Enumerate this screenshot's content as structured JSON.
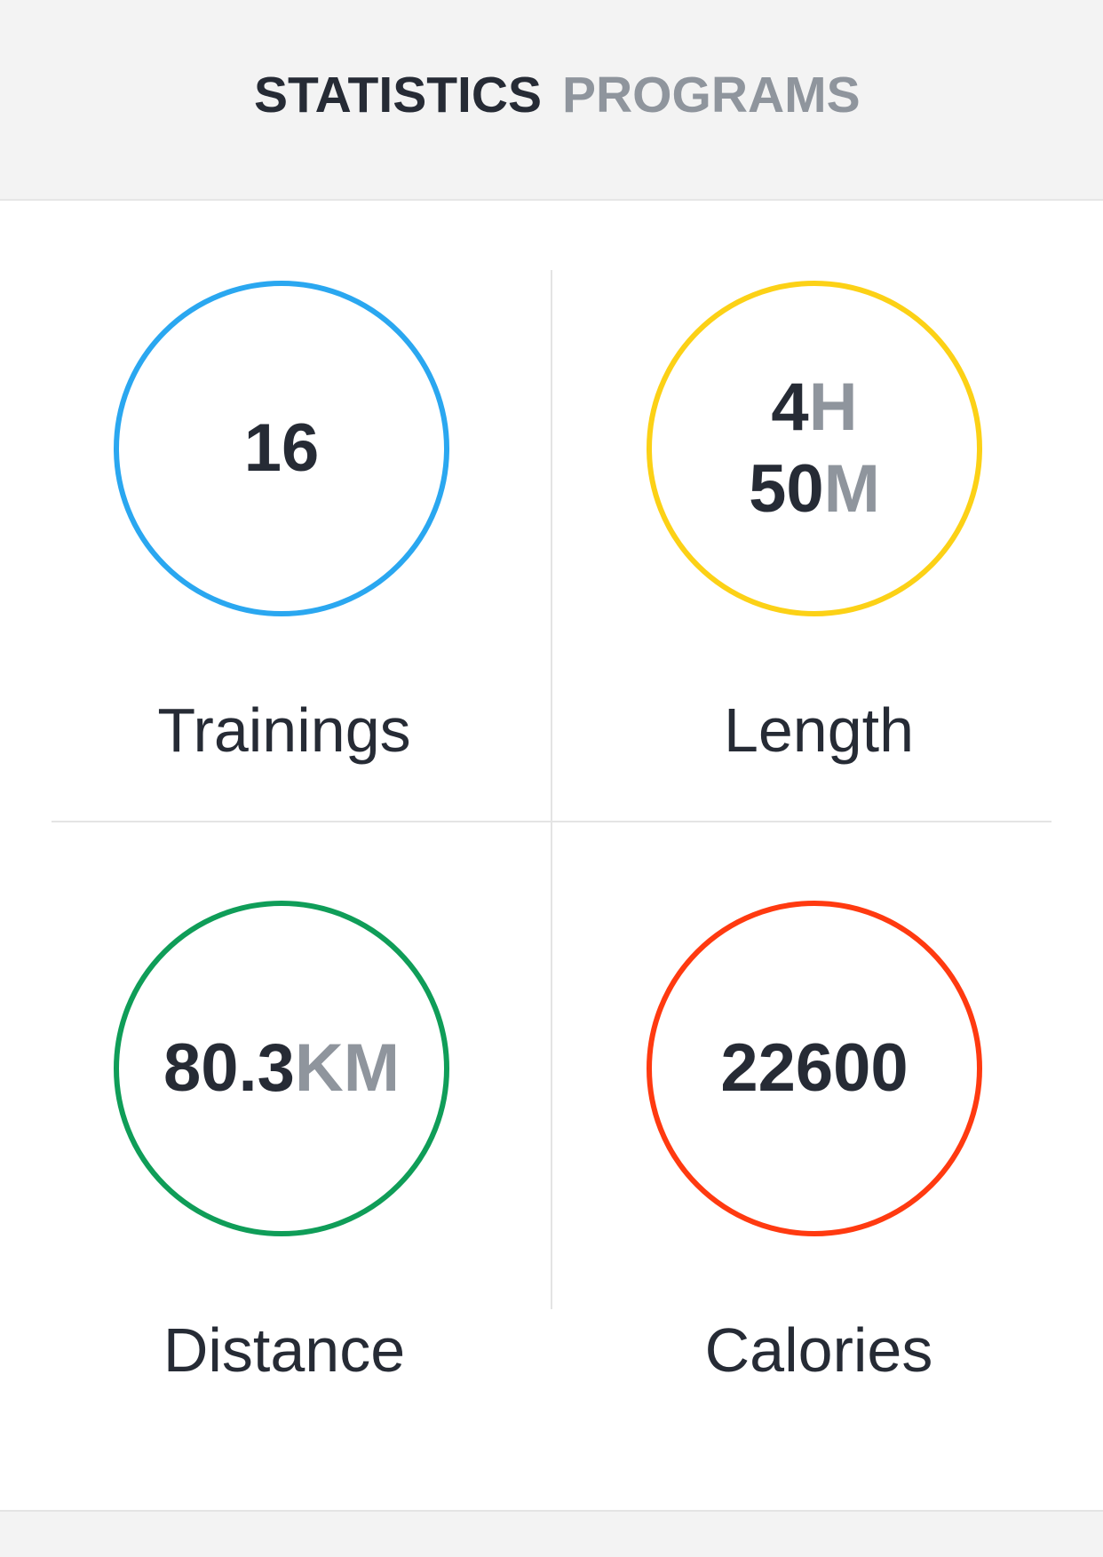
{
  "tabs": {
    "statistics": "STATISTICS",
    "programs": "PROGRAMS"
  },
  "stats": {
    "trainings": {
      "value": "16",
      "label": "Trainings",
      "color": "#2aa7f0"
    },
    "length": {
      "hours_value": "4",
      "hours_unit": "H",
      "minutes_value": "50",
      "minutes_unit": "M",
      "label": "Length",
      "color": "#fcd116"
    },
    "distance": {
      "value": "80.3",
      "unit": "KM",
      "label": "Distance",
      "color": "#0f9d58"
    },
    "calories": {
      "value": "22600",
      "label": "Calories",
      "color": "#ff3a10"
    }
  }
}
